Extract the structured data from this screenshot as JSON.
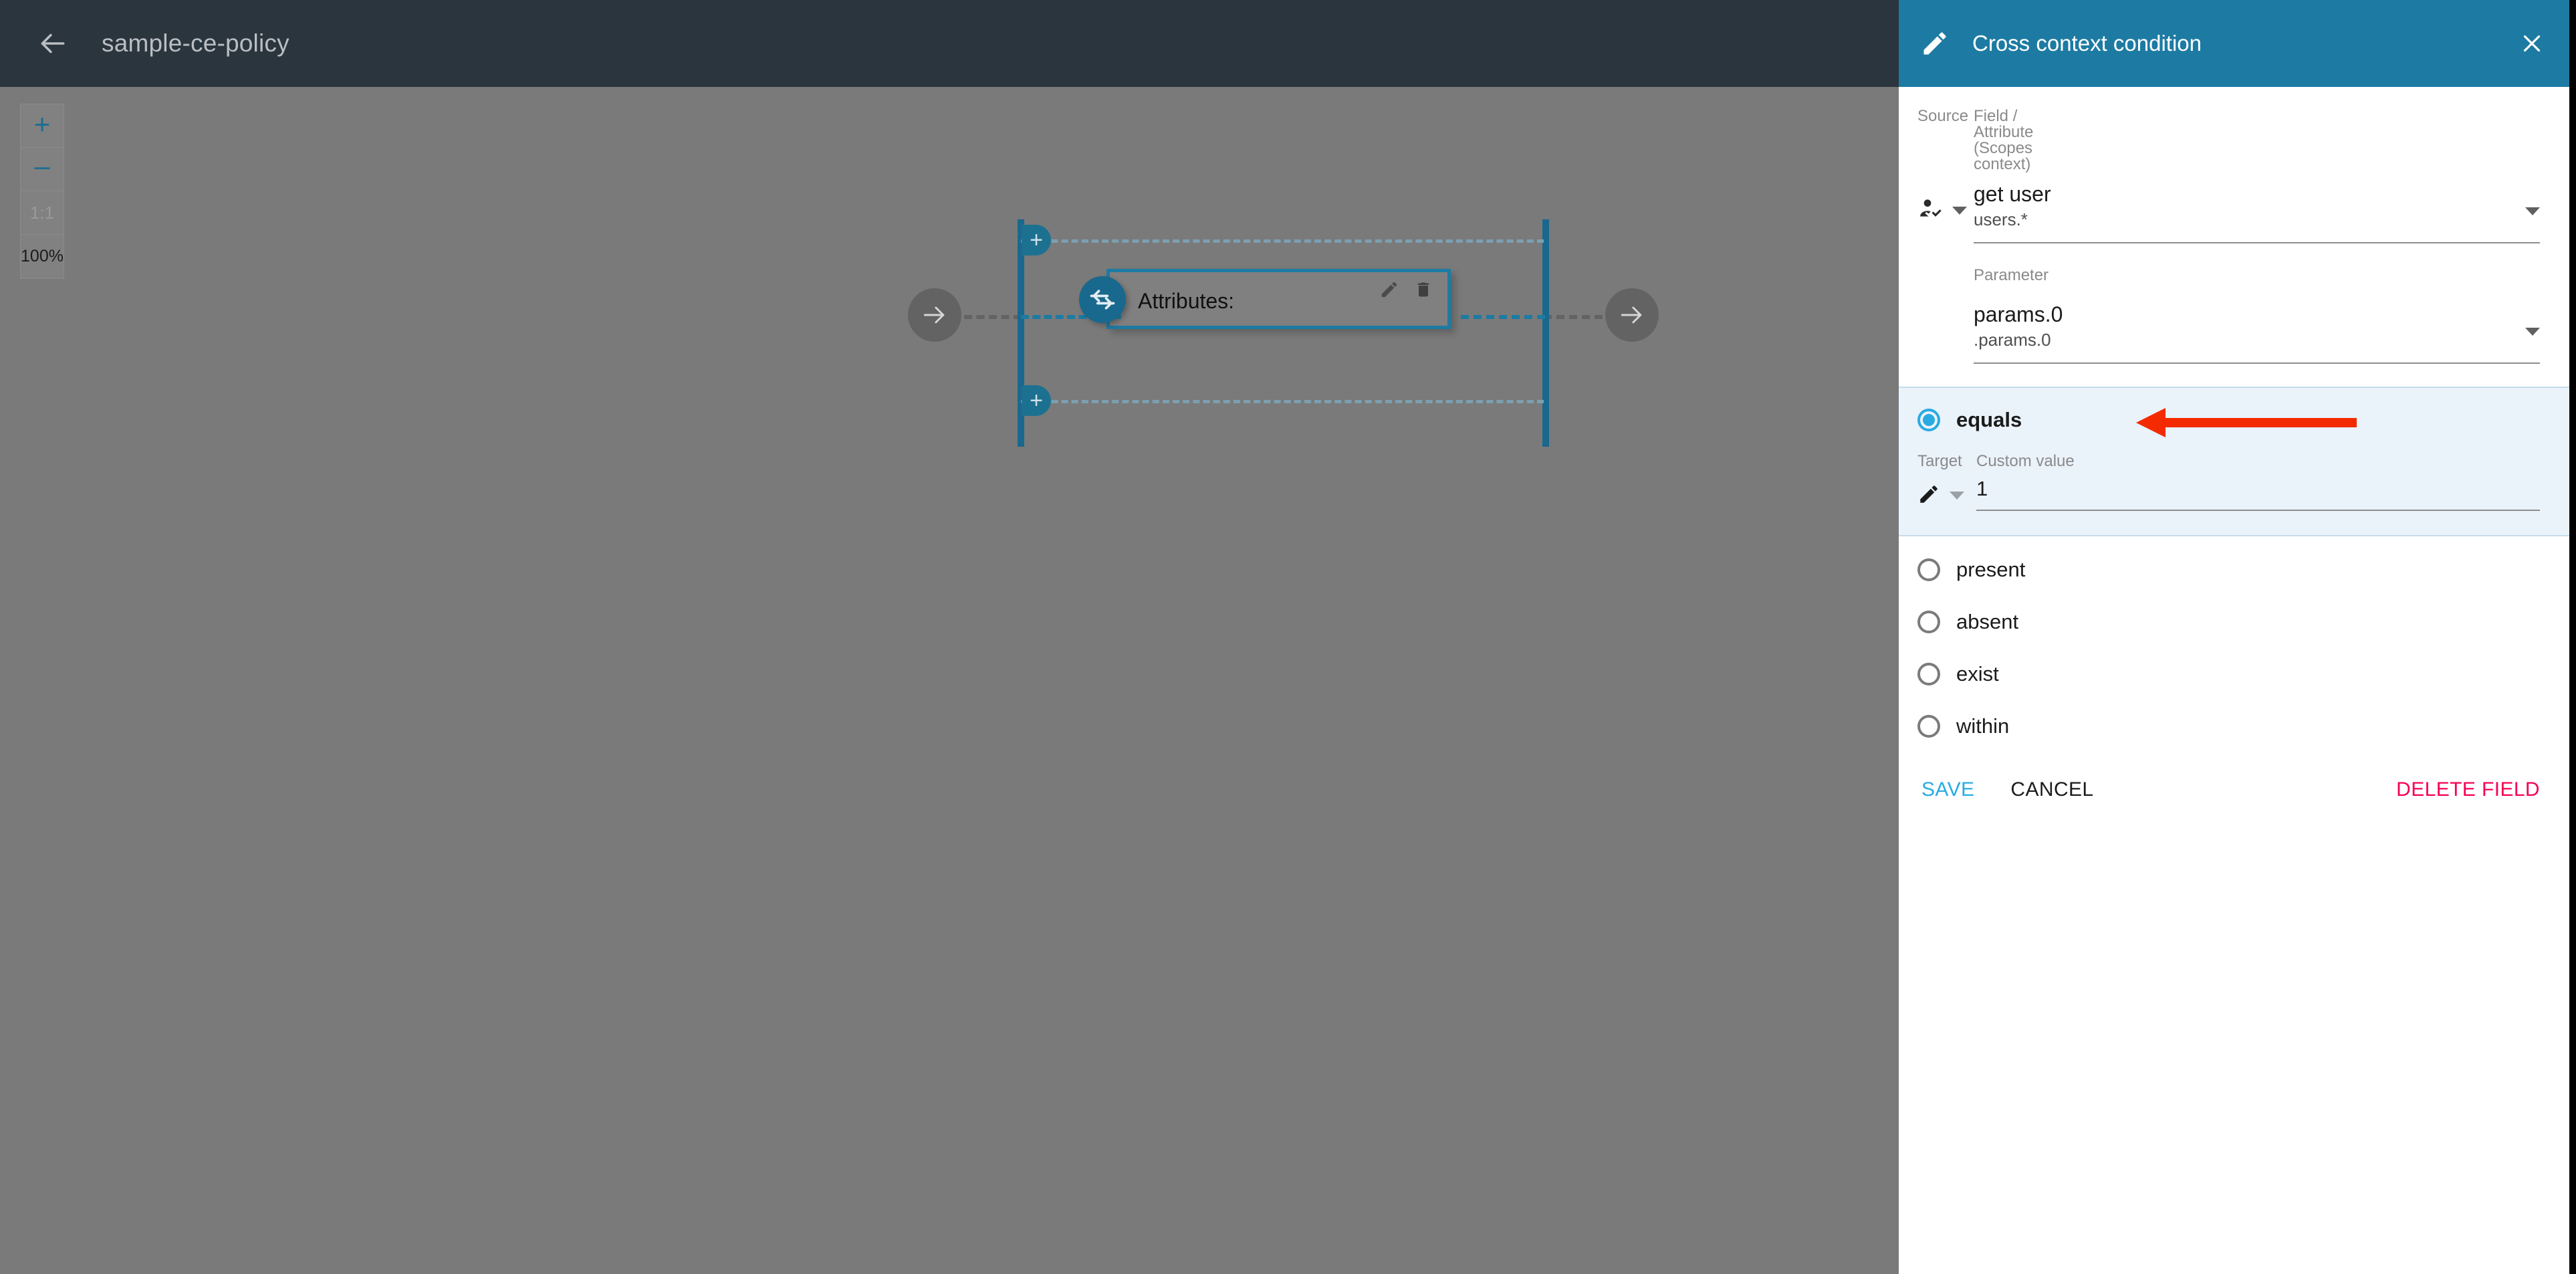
{
  "topbar": {
    "back_icon": "arrow-left-icon",
    "title": "sample-ce-policy"
  },
  "canvas": {
    "zoom_controls": {
      "zoom_in_label": "+",
      "zoom_out_label": "–",
      "fit_label": "1:1",
      "zoom_level_label": "100%"
    },
    "diagram": {
      "node_label": "Attributes:",
      "node_badge_icon": "transfer-arrows-icon",
      "node_edit_icon": "pencil-icon",
      "node_delete_icon": "trash-icon",
      "add_branch_top_label": "+",
      "add_branch_bottom_label": "+",
      "nav_left_icon": "arrow-right-circle-icon",
      "nav_right_icon": "arrow-right-circle-icon"
    }
  },
  "panel": {
    "header": {
      "icon": "pencil-icon",
      "title": "Cross context condition",
      "close_icon": "close-icon",
      "accent_color": "#1d7ba3"
    },
    "source": {
      "group_label": "Source",
      "icon": "user-check-icon",
      "field": {
        "label": "Field / Attribute (Scopes context)",
        "value": "get user",
        "sub_value": "users.*",
        "caret_icon": "chevron-down-icon"
      },
      "parameter": {
        "label": "Parameter",
        "value": "params.0",
        "sub_value": ".params.0",
        "caret_icon": "chevron-down-icon"
      }
    },
    "condition": {
      "selected_option": "equals",
      "option_label": "equals",
      "target_label": "Target",
      "target_icon": "pencil-icon",
      "target_caret_icon": "chevron-down-icon",
      "custom_value_label": "Custom value",
      "custom_value": "1",
      "highlight_color": "#eaf2fa",
      "radio_color": "#29abe2",
      "annotation": {
        "type": "arrow",
        "direction": "left",
        "color": "#f42a00"
      }
    },
    "options": [
      {
        "label": "present",
        "selected": false
      },
      {
        "label": "absent",
        "selected": false
      },
      {
        "label": "exist",
        "selected": false
      },
      {
        "label": "within",
        "selected": false
      }
    ],
    "actions": {
      "save_label": "SAVE",
      "cancel_label": "CANCEL",
      "delete_label": "DELETE FIELD",
      "save_color": "#29abe2",
      "delete_color": "#f50057"
    }
  }
}
